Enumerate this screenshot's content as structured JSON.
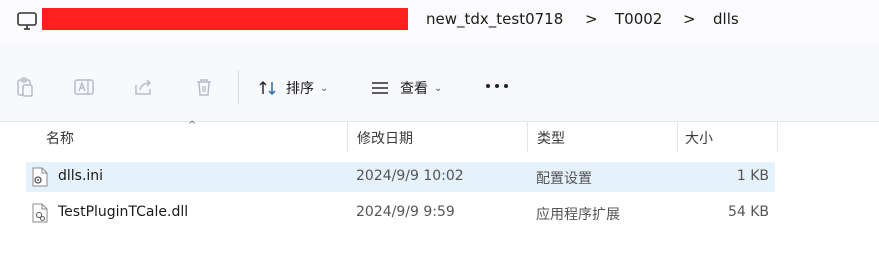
{
  "address_bar": {
    "crumbs": [
      "new_tdx_test0718",
      "T0002",
      "dlls"
    ],
    "separator": ">"
  },
  "toolbar": {
    "sort_label": "排序",
    "view_label": "查看",
    "caret": "⌄"
  },
  "columns": {
    "name": "名称",
    "modified": "修改日期",
    "type": "类型",
    "size": "大小"
  },
  "files": [
    {
      "name": "dlls.ini",
      "modified": "2024/9/9 10:02",
      "type": "配置设置",
      "size": "1 KB",
      "selected": true,
      "icon": "settings-file-icon"
    },
    {
      "name": "TestPluginTCale.dll",
      "modified": "2024/9/9 9:59",
      "type": "应用程序扩展",
      "size": "54 KB",
      "selected": false,
      "icon": "dll-file-icon"
    }
  ],
  "colors": {
    "redaction": "#ff1f1f",
    "selection": "#e5f1fb"
  }
}
